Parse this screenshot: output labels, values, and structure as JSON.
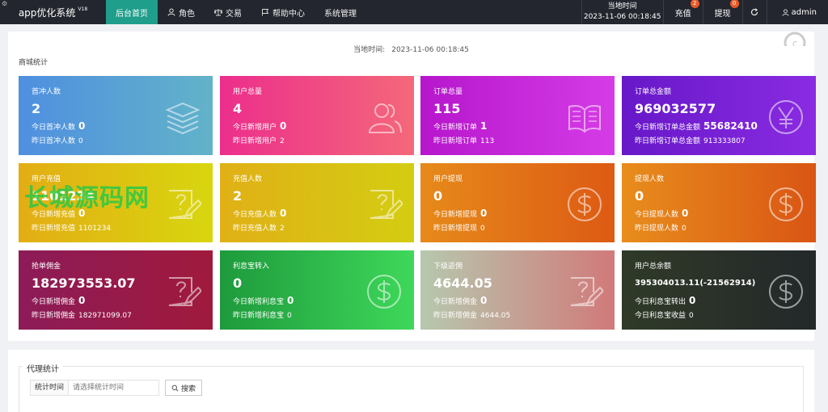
{
  "header": {
    "brand": "app优化系统",
    "version": "V18",
    "nav": [
      {
        "label": "后台首页"
      },
      {
        "label": "角色"
      },
      {
        "label": "交易"
      },
      {
        "label": "帮助中心"
      },
      {
        "label": "系统管理"
      }
    ],
    "time_label": "当地时间",
    "time_value": "2023-11-06 00:18:45",
    "recharge_label": "充值",
    "recharge_count": "2",
    "withdraw_label": "提现",
    "withdraw_count": "0",
    "user": "admin"
  },
  "overview": {
    "time_label": "当地时间:",
    "time_value": "2023-11-06 00:18:45",
    "section_title": "商城统计",
    "cards": [
      {
        "title": "首冲人数",
        "value": "2",
        "row1_label": "今日首冲人数",
        "row1_value": "0",
        "row2_label": "昨日首冲人数",
        "row2_value": "0",
        "icon": "layers-icon",
        "gradient": [
          "#4f8fe0",
          "#62b3c9"
        ]
      },
      {
        "title": "用户总量",
        "value": "4",
        "row1_label": "今日新增用户",
        "row1_value": "0",
        "row2_label": "昨日新增用户",
        "row2_value": "2",
        "icon": "users-icon",
        "gradient": [
          "#ec2e8c",
          "#f4687a"
        ]
      },
      {
        "title": "订单总量",
        "value": "115",
        "row1_label": "今日新增订单",
        "row1_value": "1",
        "row2_label": "昨日新增订单",
        "row2_value": "113",
        "icon": "book-icon",
        "gradient": [
          "#b616cc",
          "#d53ce6"
        ]
      },
      {
        "title": "订单总金额",
        "value": "969032577",
        "row1_label": "今日新增订单总金额",
        "row1_value": "55682410",
        "row2_label": "昨日新增订单总金额",
        "row2_value": "913333807",
        "icon": "yen-icon",
        "gradient": [
          "#6718c8",
          "#8a2be2"
        ]
      },
      {
        "title": "用户充值",
        "value": "1101234",
        "row1_label": "今日新增充值",
        "row1_value": "0",
        "row2_label": "昨日新增充值",
        "row2_value": "1101234",
        "icon": "edit-icon",
        "gradient": [
          "#e3ad14",
          "#d8d60f"
        ]
      },
      {
        "title": "充值人数",
        "value": "2",
        "row1_label": "今日充值人数",
        "row1_value": "0",
        "row2_label": "昨日充值人数",
        "row2_value": "2",
        "icon": "edit-icon",
        "gradient": [
          "#e0b016",
          "#d4cd12"
        ]
      },
      {
        "title": "用户提现",
        "value": "0",
        "row1_label": "今日新增提现",
        "row1_value": "0",
        "row2_label": "昨日新增提现",
        "row2_value": "0",
        "icon": "dollar-icon",
        "gradient": [
          "#e68a1a",
          "#dd5a14"
        ]
      },
      {
        "title": "提现人数",
        "value": "0",
        "row1_label": "今日提现人数",
        "row1_value": "0",
        "row2_label": "昨日提现人数",
        "row2_value": "0",
        "icon": "dollar-icon",
        "gradient": [
          "#e88d1c",
          "#d95514"
        ]
      },
      {
        "title": "抢单佣金",
        "value": "182973553.07",
        "row1_label": "今日新增佣金",
        "row1_value": "0",
        "row2_label": "昨日新增佣金",
        "row2_value": "182971099.07",
        "icon": "edit-icon",
        "gradient": [
          "#8c1b58",
          "#a01a3c"
        ]
      },
      {
        "title": "利息宝转入",
        "value": "0",
        "row1_label": "今日新增利息宝",
        "row1_value": "0",
        "row2_label": "昨日新增利息宝",
        "row2_value": "0",
        "icon": "dollar-icon",
        "gradient": [
          "#1e9a3c",
          "#3ed85a"
        ]
      },
      {
        "title": "下级返佣",
        "value": "4644.05",
        "row1_label": "今日新增佣金",
        "row1_value": "0",
        "row2_label": "昨日新增佣金",
        "row2_value": "4644.05",
        "icon": "edit-icon",
        "gradient": [
          "#b6c8ae",
          "#d17a7a"
        ]
      },
      {
        "title": "用户总余额",
        "value": "395304013.11(-21562914)",
        "row1_label": "今日利息宝转出",
        "row1_value": "0",
        "row2_label": "今日利息宝收益",
        "row2_value": "0",
        "icon": "dollar-icon",
        "gradient": [
          "#303a28",
          "#23282a"
        ]
      }
    ]
  },
  "agent": {
    "legend": "代理统计",
    "field_label": "统计时间",
    "field_placeholder": "请选择统计时间",
    "search_label": "搜索"
  },
  "watermark": "长城源码网"
}
